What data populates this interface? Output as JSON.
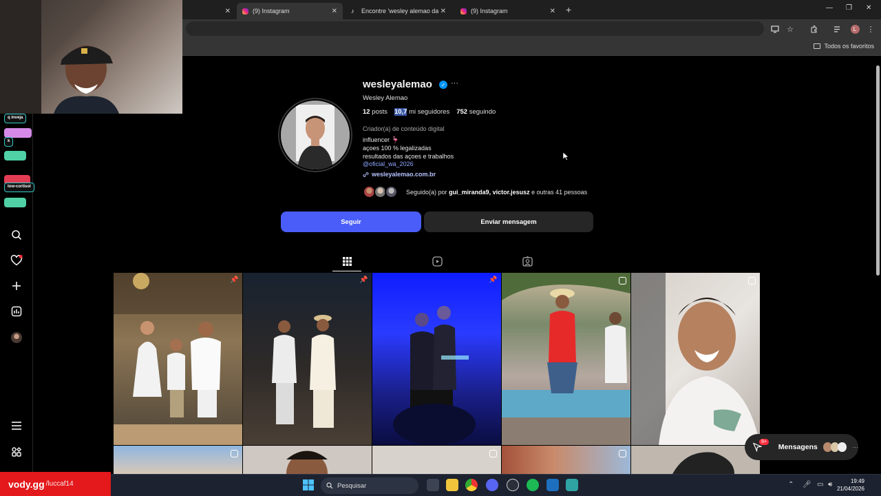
{
  "browser": {
    "tabs": [
      {
        "title": "",
        "kind": "ig",
        "active": false
      },
      {
        "title": "(9) Instagram",
        "kind": "ig",
        "active": true
      },
      {
        "title": "Encontre 'wesley alemao dançan",
        "kind": "tiktok",
        "active": false
      },
      {
        "title": "(9) Instagram",
        "kind": "ig",
        "active": false
      }
    ],
    "bookmarks_all": "Todos os favoritos",
    "profile_letter": "L"
  },
  "chat_overlay": {
    "chips": [
      "q inveja",
      "k",
      "low-cortisol"
    ]
  },
  "profile": {
    "username": "wesleyalemao",
    "full_name": "Wesley Alemao",
    "posts_count": "12",
    "posts_label": "posts",
    "followers_count": "10,7",
    "followers_label": "mi seguidores",
    "following_count": "752",
    "following_label": "seguindo",
    "category": "Criador(a) de conteúdo digital",
    "bio_line1": "influencer 🦩",
    "bio_line2": "açoes 100 % legalizadas",
    "bio_line3": "resultados das açoes e trabalhos",
    "mention": "@oficial_wa_2026",
    "link": "wesleyalemao.com.br",
    "followed_by_prefix": "Seguido(a) por",
    "followed_by_names": "gui_miranda9, victor.jesusz",
    "followed_by_suffix": "e outras 41 pessoas",
    "follow_button": "Seguir",
    "message_button": "Enviar mensagem"
  },
  "messages_pill": {
    "label": "Mensagens",
    "badge": "9+"
  },
  "taskbar": {
    "search_placeholder": "Pesquisar",
    "time": "19:49",
    "date": "21/04/2026"
  },
  "watermark": {
    "brand": "vody.gg",
    "channel": "/luccaf14"
  },
  "colors": {
    "follow_button": "#4a5df9",
    "verified": "#0095f6",
    "notification": "#ff3040"
  }
}
